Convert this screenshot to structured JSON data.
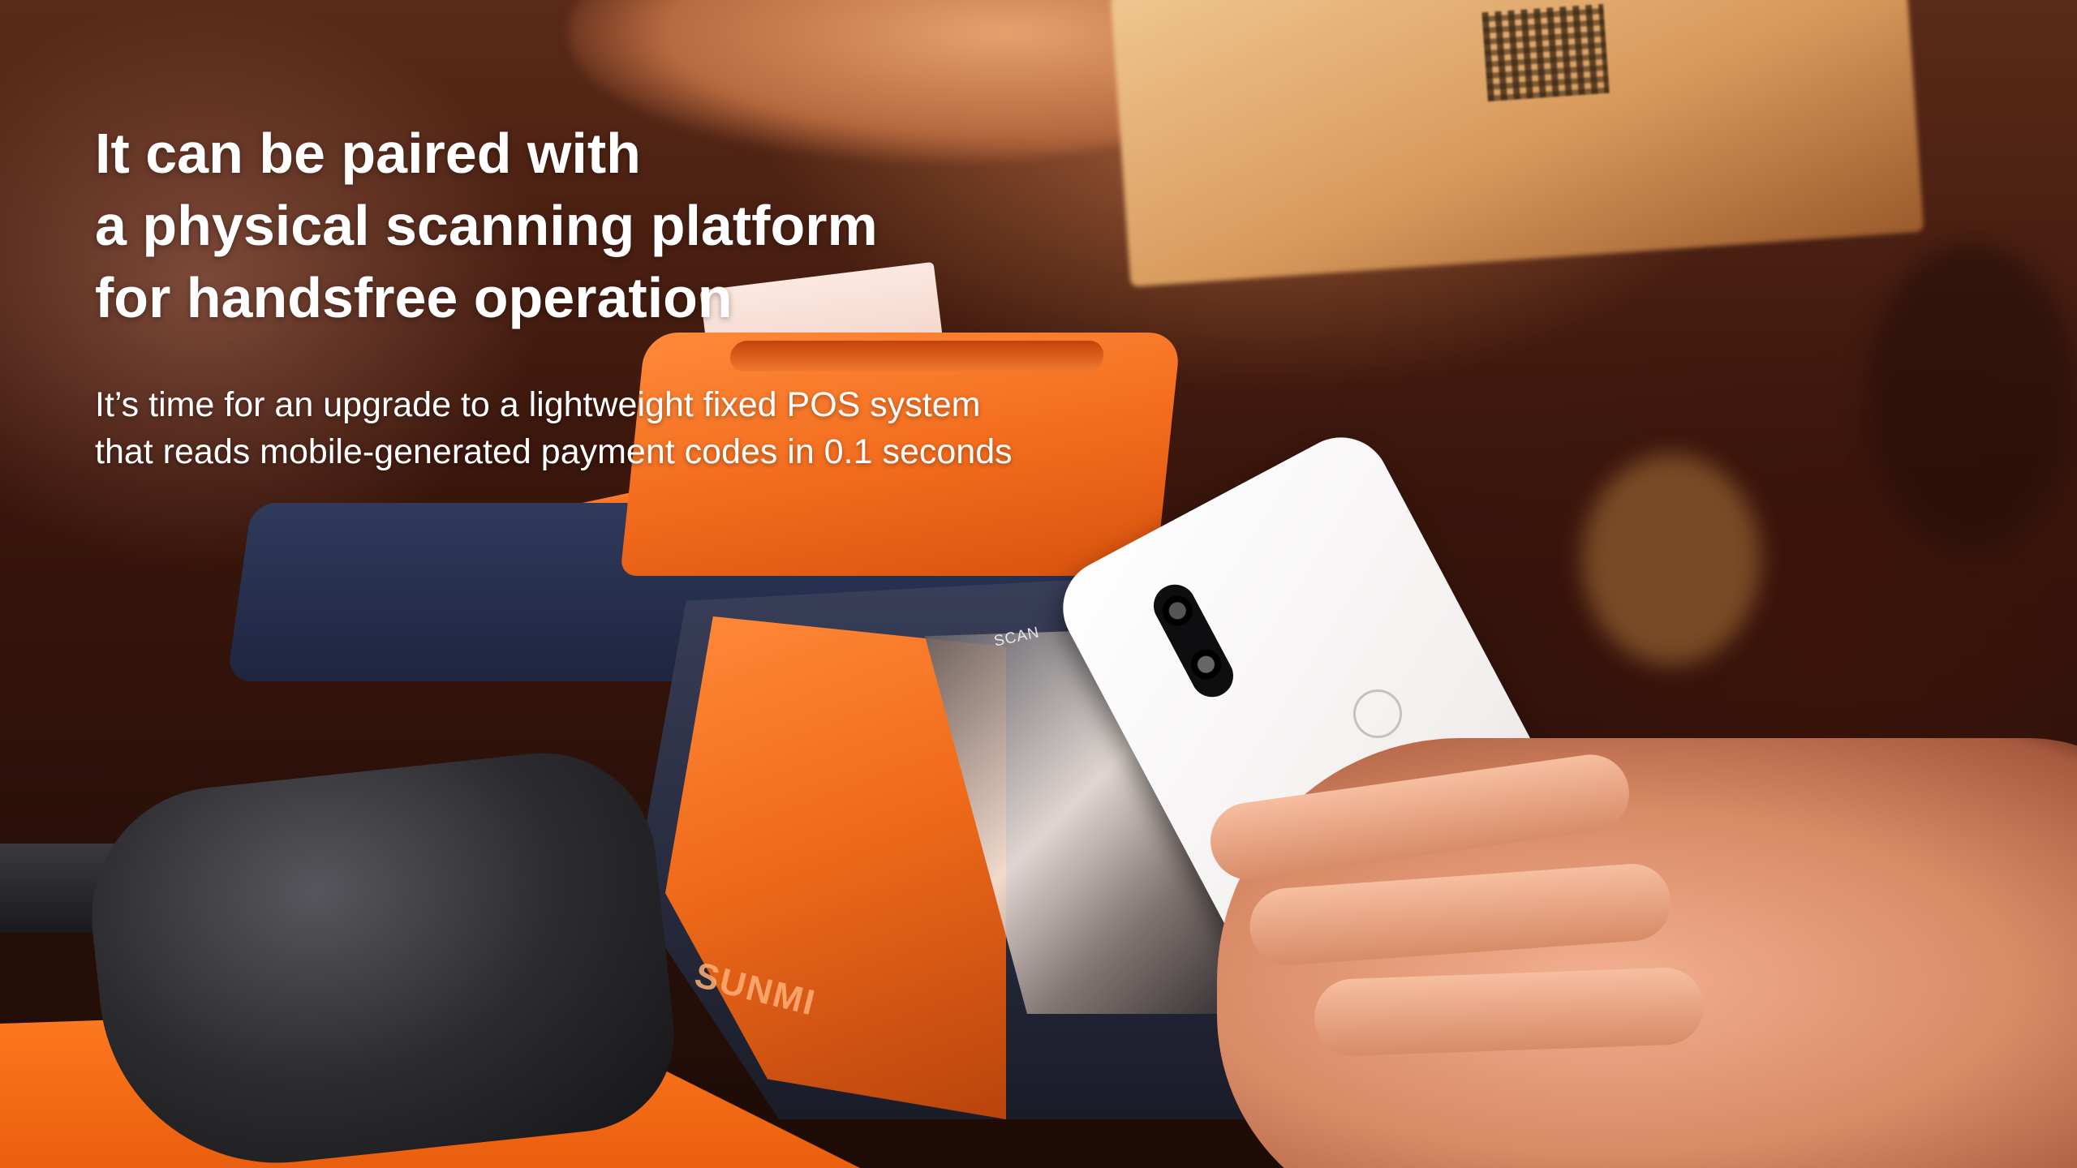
{
  "slide": {
    "headline_lines": [
      "It can be paired with",
      "a physical scanning platform",
      "for handsfree operation"
    ],
    "subtext_lines": [
      "It’s time for an upgrade to a lightweight fixed POS system",
      "that reads mobile-generated payment codes in 0.1 seconds"
    ]
  },
  "device": {
    "scan_label": "SCAN",
    "brand": "SUNMI"
  },
  "colors": {
    "accent_orange": "#f26a1c",
    "device_navy": "#2a3150",
    "text": "#ffffff"
  }
}
